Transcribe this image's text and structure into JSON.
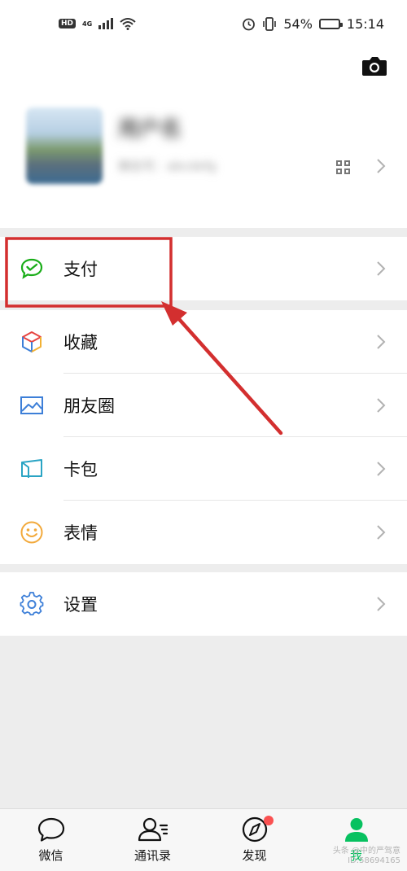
{
  "status_bar": {
    "hd": "HD",
    "network": "4G",
    "battery": "54%",
    "battery_level": 0.54,
    "time": "15:14"
  },
  "profile": {
    "nickname": "用户名",
    "wechat_id": "微信号：abcdefg",
    "icons": [
      "camera-icon",
      "qr-code-icon",
      "chevron-right-icon"
    ]
  },
  "menu": {
    "pay": {
      "label": "支付",
      "icon": "wechat-pay-icon",
      "color": "#1aad19"
    },
    "favorites": {
      "label": "收藏",
      "icon": "cube-icon"
    },
    "moments": {
      "label": "朋友圈",
      "icon": "photo-icon",
      "color": "#3d7fd8"
    },
    "cards": {
      "label": "卡包",
      "icon": "card-wallet-icon",
      "color": "#2aa4c4"
    },
    "stickers": {
      "label": "表情",
      "icon": "smiley-icon",
      "color": "#f2a93b"
    },
    "settings": {
      "label": "设置",
      "icon": "gear-icon",
      "color": "#3d7fd8"
    }
  },
  "tabbar": {
    "chats": "微信",
    "contacts": "通讯录",
    "discover": "发现",
    "me": "我",
    "active": "me",
    "accent": "#07c160",
    "badge_color": "#fa5151"
  },
  "watermark": {
    "line1": "头条 @中的严驾意",
    "line2": "ID:58694165"
  },
  "annotation": {
    "color": "#d32f2f"
  }
}
